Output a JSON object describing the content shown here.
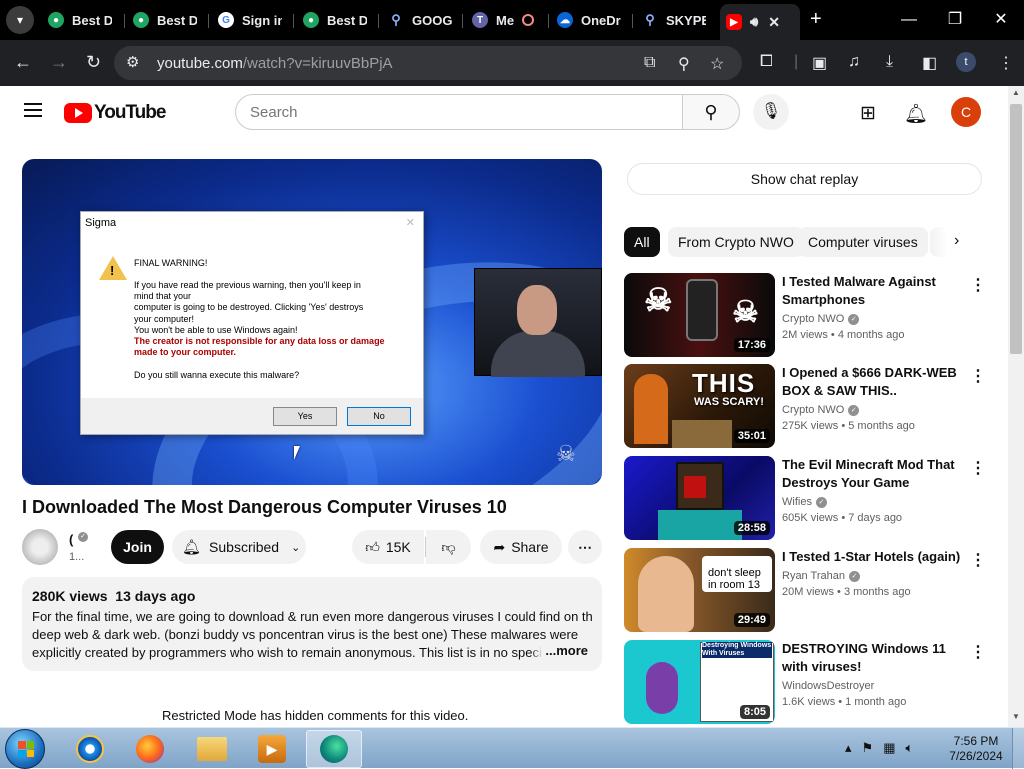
{
  "browser": {
    "tabs": [
      {
        "label": "Best Di",
        "icon": "green-circle-icon"
      },
      {
        "label": "Best Di",
        "icon": "green-circle-icon"
      },
      {
        "label": "Sign in",
        "icon": "google-icon"
      },
      {
        "label": "Best Di",
        "icon": "green-circle-icon"
      },
      {
        "label": "GOOGI",
        "icon": "search-icon"
      },
      {
        "label": "Me",
        "icon": "teams-icon"
      },
      {
        "label": "OneDri",
        "icon": "onedrive-icon"
      },
      {
        "label": "SKYPE",
        "icon": "search-icon"
      }
    ],
    "url_host": "youtube.com",
    "url_path": "/watch?v=kiruuvBbPjA",
    "profile_initial": "t"
  },
  "youtube": {
    "logo_text": "YouTube",
    "search_placeholder": "Search",
    "avatar_initial": "C",
    "video": {
      "title": "I Downloaded The Most Dangerous Computer Viruses 10",
      "channel_initial": "(",
      "channel_subs": "1...",
      "join_label": "Join",
      "subscribed_label": "Subscribed",
      "likes": "15K",
      "share_label": "Share",
      "views": "280K views",
      "age": "13 days ago",
      "description_lines": [
        "For the final time, we are going to download & run even more dangerous viruses I could find on the",
        "deep web & dark web. (bonzi buddy vs poncentran virus is the best one) These malwares were",
        "explicitly created by programmers who wish to remain anonymous. This list is in no specific"
      ],
      "more_label": "...more",
      "restricted_notice": "Restricted Mode has hidden comments for this video."
    },
    "dialog": {
      "title": "Sigma",
      "heading": "FINAL WARNING!",
      "lines": [
        "If you have read the previous warning, then you'll keep in",
        "mind that your",
        "computer is going to be destroyed. Clicking 'Yes' destroys",
        "your computer!",
        "You won't be able to use Windows again!"
      ],
      "red_lines": [
        "The creator is not responsible for any data loss or damage",
        "made to your computer."
      ],
      "question": "Do you still wanna execute this malware?",
      "yes": "Yes",
      "no": "No"
    },
    "chat_replay": "Show chat replay",
    "chips": [
      "All",
      "From Crypto NWO",
      "Computer viruses"
    ],
    "recommendations": [
      {
        "title": "I Tested Malware Against Smartphones",
        "channel": "Crypto NWO",
        "verified": true,
        "views": "2M views",
        "age": "4 months ago",
        "duration": "17:36"
      },
      {
        "title": "I Opened a $666 DARK-WEB BOX & SAW THIS..",
        "channel": "Crypto NWO",
        "verified": true,
        "views": "275K views",
        "age": "5 months ago",
        "duration": "35:01",
        "thumb_text": [
          "THIS",
          "WAS SCARY!"
        ]
      },
      {
        "title": "The Evil Minecraft Mod That Destroys Your Game",
        "channel": "Wifies",
        "verified": true,
        "views": "605K views",
        "age": "7 days ago",
        "duration": "28:58"
      },
      {
        "title": "I Tested 1-Star Hotels (again)",
        "channel": "Ryan Trahan",
        "verified": true,
        "views": "20M views",
        "age": "3 months ago",
        "duration": "29:49",
        "thumb_text": [
          "don't sleep",
          "in room 13"
        ]
      },
      {
        "title": "DESTROYING Windows 11 with viruses!",
        "channel": "WindowsDestroyer",
        "verified": false,
        "views": "1.6K views",
        "age": "1 month ago",
        "duration": "8:05",
        "thumb_text": [
          "Destroying Windows 11",
          "With Viruses"
        ]
      }
    ]
  },
  "taskbar": {
    "time": "7:56 PM",
    "date": "7/26/2024"
  },
  "colors": {
    "yt_red": "#ff0000",
    "chrome_dark": "#202124",
    "taskbar": "#8fb0d2"
  }
}
